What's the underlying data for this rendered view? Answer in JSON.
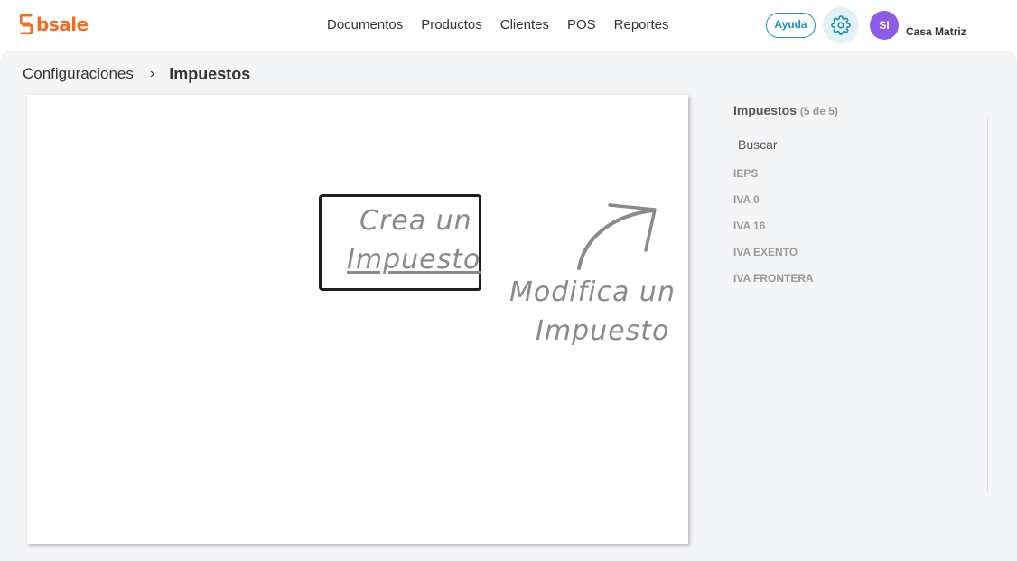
{
  "brand": {
    "name": "bsale",
    "color": "#f26c22",
    "icon": "bsale-logo-icon"
  },
  "nav": {
    "items": [
      {
        "label": "Documentos"
      },
      {
        "label": "Productos"
      },
      {
        "label": "Clientes"
      },
      {
        "label": "POS"
      },
      {
        "label": "Reportes"
      }
    ]
  },
  "header": {
    "help_label": "Ayuda",
    "settings_icon": "gear-icon",
    "avatar_initials": "SI",
    "avatar_color": "#8c5ce8",
    "branch": "Casa Matriz"
  },
  "breadcrumb": {
    "parent": "Configuraciones",
    "separator": "›",
    "current": "Impuestos"
  },
  "canvas": {
    "create_line1": "Crea un",
    "create_line2": "Impuesto",
    "modify_line1": "Modifica un",
    "modify_line2": "Impuesto",
    "arrow_icon": "curved-arrow-icon"
  },
  "sidebar": {
    "title": "Impuestos",
    "count": "(5 de 5)",
    "search_placeholder": "Buscar",
    "items": [
      {
        "label": "IEPS"
      },
      {
        "label": "IVA 0"
      },
      {
        "label": "IVA 16"
      },
      {
        "label": "IVA EXENTO"
      },
      {
        "label": "IVA FRONTERA"
      }
    ]
  }
}
